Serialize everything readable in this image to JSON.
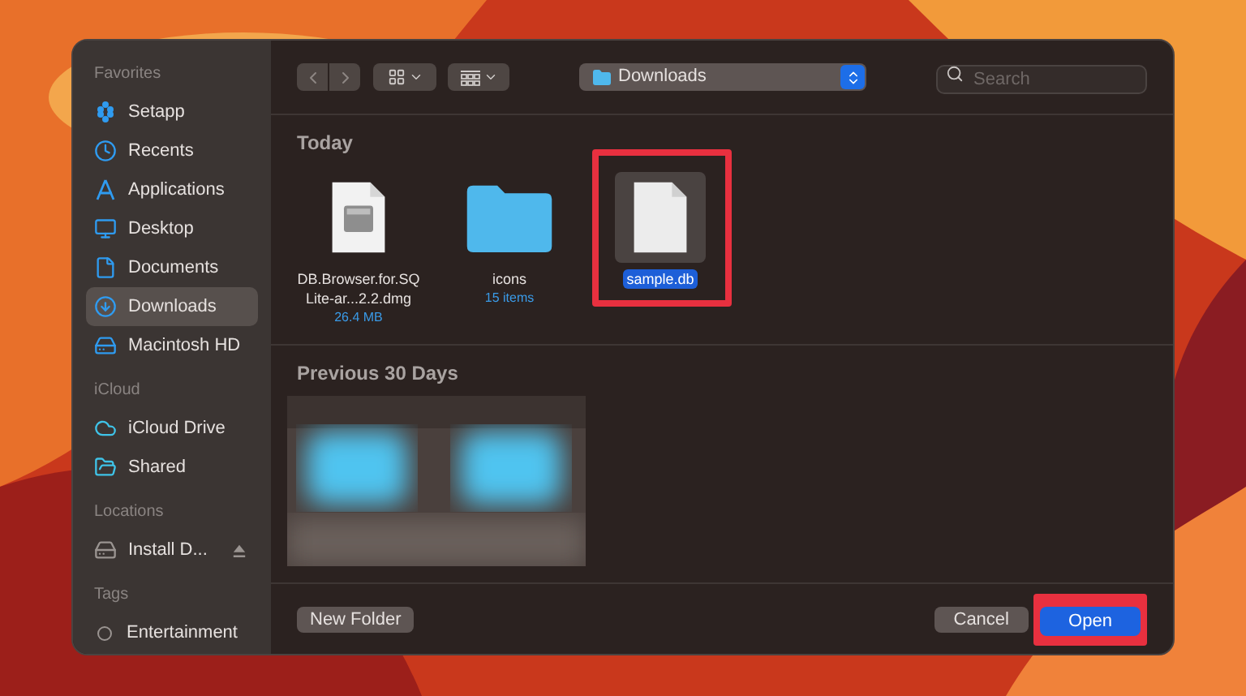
{
  "sidebar": [
    {
      "heading": "Favorites",
      "items": [
        {
          "label": "Setapp",
          "selected": false
        },
        {
          "label": "Recents",
          "selected": false
        },
        {
          "label": "Applications",
          "selected": false
        },
        {
          "label": "Desktop",
          "selected": false
        },
        {
          "label": "Documents",
          "selected": false
        },
        {
          "label": "Downloads",
          "selected": true
        },
        {
          "label": "Macintosh HD",
          "selected": false
        }
      ]
    },
    {
      "heading": "iCloud",
      "items": [
        {
          "label": "iCloud Drive",
          "selected": false
        },
        {
          "label": "Shared",
          "selected": false
        }
      ]
    },
    {
      "heading": "Locations",
      "items": [
        {
          "label": "Install D...",
          "selected": false,
          "ejectable": true
        }
      ]
    },
    {
      "heading": "Tags",
      "items": [
        {
          "label": "Entertainment",
          "selected": false
        }
      ]
    }
  ],
  "toolbar": {
    "location": "Downloads",
    "search": {
      "placeholder": "Search"
    }
  },
  "sections": [
    {
      "title": "Today",
      "files": [
        {
          "kind": "dmg",
          "name": "DB.Browser.for.SQLite-ar...2.2.dmg",
          "detail": "26.4 MB",
          "selected": false,
          "highlighted": false
        },
        {
          "kind": "folder",
          "name": "icons",
          "detail": "15 items",
          "selected": false,
          "highlighted": false
        },
        {
          "kind": "file",
          "name": "sample.db",
          "selected": true,
          "highlighted": true
        }
      ]
    },
    {
      "title": "Previous 30 Days"
    }
  ],
  "footer": {
    "new_folder": "New Folder",
    "cancel": "Cancel",
    "open": "Open",
    "open_highlighted": true
  }
}
